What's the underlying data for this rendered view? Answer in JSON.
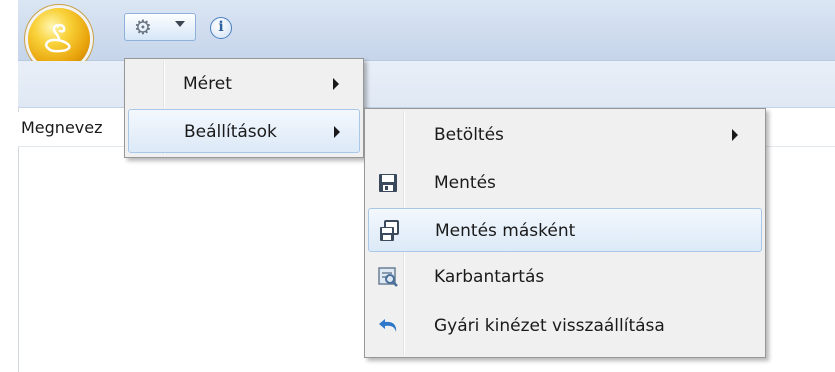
{
  "toolbar": {
    "app_orb_icon": "cobra-logo-icon",
    "settings_icon": "gear-icon",
    "settings_dropdown_icon": "caret-down-icon",
    "info_icon": "info-icon",
    "info_glyph": "i"
  },
  "column_header": {
    "label": "Megnevez"
  },
  "main_menu": {
    "items": [
      {
        "label": "Méret",
        "has_submenu": true,
        "highlighted": false
      },
      {
        "label": "Beállítások",
        "has_submenu": true,
        "highlighted": true
      }
    ]
  },
  "submenu": {
    "items": [
      {
        "label": "Betöltés",
        "icon": "",
        "has_submenu": true,
        "highlighted": false
      },
      {
        "label": "Mentés",
        "icon": "floppy-disk-icon",
        "has_submenu": false,
        "highlighted": false
      },
      {
        "label": "Mentés másként",
        "icon": "save-as-icon",
        "has_submenu": false,
        "highlighted": true
      },
      {
        "label": "Karbantartás",
        "icon": "maintenance-icon",
        "has_submenu": false,
        "highlighted": false
      },
      {
        "label": "Gyári kinézet visszaállítása",
        "icon": "undo-arrow-icon",
        "has_submenu": false,
        "highlighted": false
      }
    ]
  },
  "colors": {
    "menu_background": "#f0f0f0",
    "highlight_border": "#a9c7e8",
    "orb_gold": "#e9a40c",
    "undo_arrow_blue": "#2f77c8"
  }
}
